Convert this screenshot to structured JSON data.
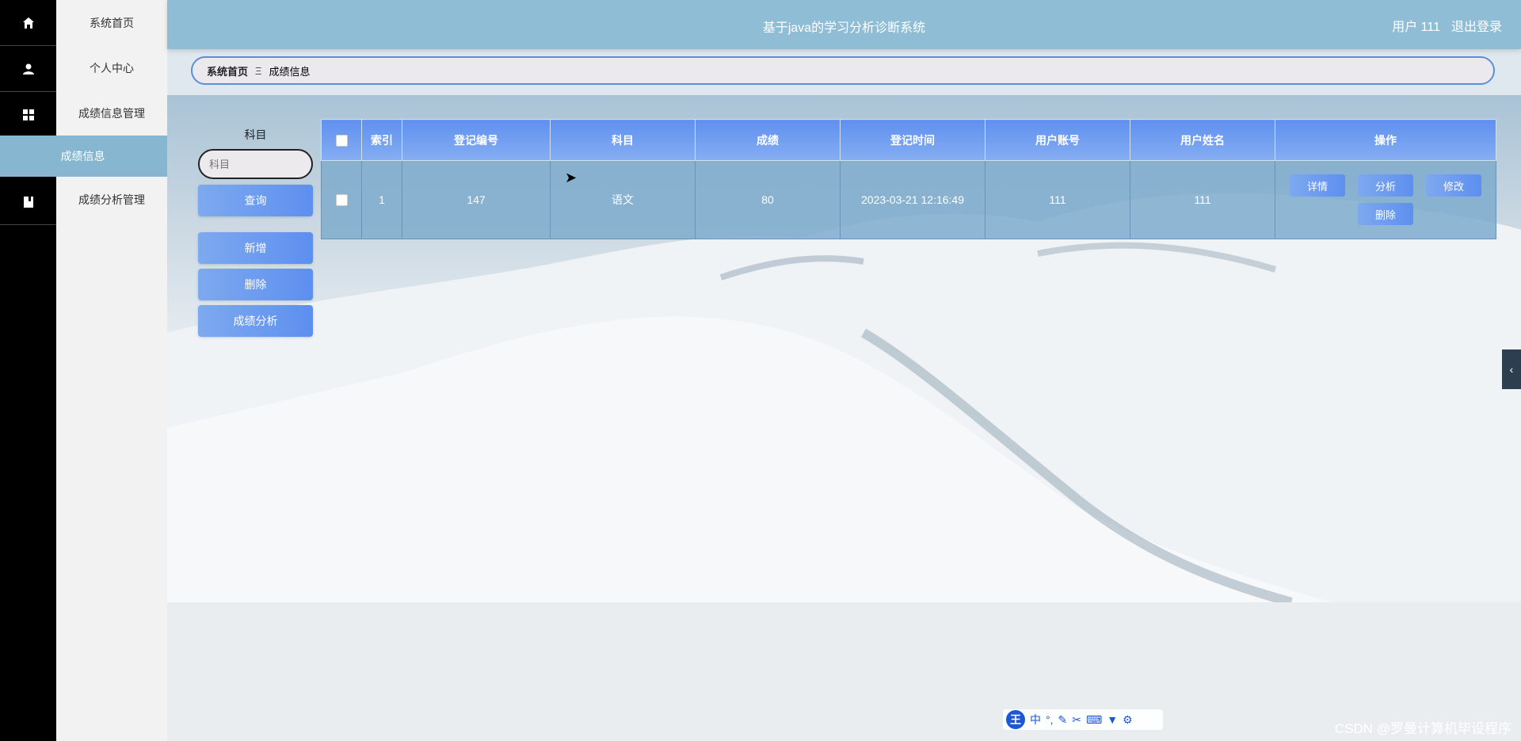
{
  "app": {
    "title": "基于java的学习分析诊断系统",
    "user_label": "用户 111",
    "logout_label": "退出登录"
  },
  "menu": {
    "items": [
      {
        "label": "系统首页",
        "icon": "home-icon"
      },
      {
        "label": "个人中心",
        "icon": "user-icon"
      },
      {
        "label": "成绩信息管理",
        "icon": "grid-icon"
      },
      {
        "label": "成绩信息",
        "icon": ""
      },
      {
        "label": "成绩分析管理",
        "icon": "book-icon"
      }
    ],
    "active": "成绩信息"
  },
  "breadcrumb": {
    "home": "系统首页",
    "separator": "Ξ",
    "current": "成绩信息"
  },
  "search": {
    "label": "科目",
    "placeholder": "科目",
    "query_button": "查询"
  },
  "actions": {
    "add": "新增",
    "delete": "删除",
    "analysis": "成绩分析"
  },
  "table": {
    "headers": [
      "索引",
      "登记编号",
      "科目",
      "成绩",
      "登记时间",
      "用户账号",
      "用户姓名",
      "操作"
    ],
    "rows": [
      {
        "index": "1",
        "reg_no": "147",
        "subject": "语文",
        "score": "80",
        "time": "2023-03-21 12:16:49",
        "account": "111",
        "name": "111",
        "ops": {
          "detail": "详情",
          "analyze": "分析",
          "edit": "修改",
          "delete": "删除"
        }
      }
    ]
  },
  "ime_bar": {
    "logo": "王",
    "mode": "中",
    "punct": "°,"
  },
  "watermark": "CSDN @罗曼计算机毕设程序",
  "colors": {
    "header": "#8fbdd6",
    "accent": "#5d8ff0",
    "active_menu": "#86b6d0"
  }
}
